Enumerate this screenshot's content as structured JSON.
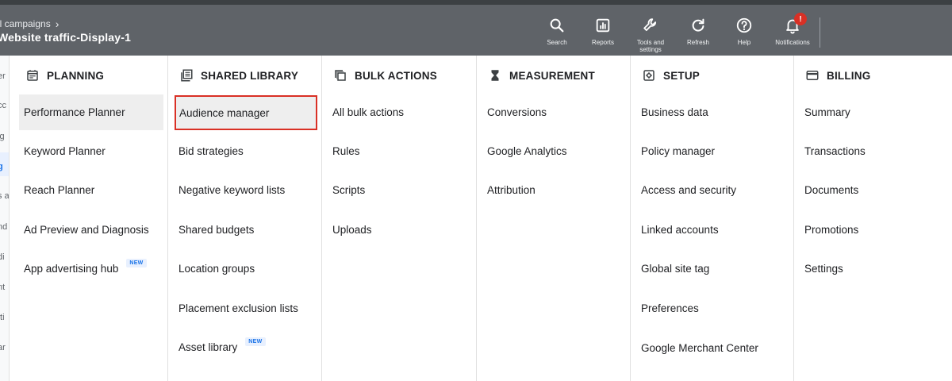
{
  "header": {
    "breadcrumb": "ll campaigns",
    "title": "Website traffic-Display-1",
    "tools": [
      {
        "label": "Search",
        "icon": "search-icon"
      },
      {
        "label": "Reports",
        "icon": "reports-icon"
      },
      {
        "label": "Tools and settings",
        "icon": "wrench-icon"
      },
      {
        "label": "Refresh",
        "icon": "refresh-icon"
      },
      {
        "label": "Help",
        "icon": "help-icon"
      },
      {
        "label": "Notifications",
        "icon": "bell-icon",
        "badge": "!"
      }
    ]
  },
  "left_rail": [
    "er",
    "cc",
    "ig",
    "g",
    "s a",
    "nd",
    "di",
    "nt",
    "tti",
    "ar"
  ],
  "columns": [
    {
      "heading": "PLANNING",
      "icon": "calendar-icon",
      "items": [
        {
          "label": "Performance Planner",
          "state": "selected"
        },
        {
          "label": "Keyword Planner"
        },
        {
          "label": "Reach Planner"
        },
        {
          "label": "Ad Preview and Diagnosis"
        },
        {
          "label": "App advertising hub",
          "badge": "NEW"
        }
      ]
    },
    {
      "heading": "SHARED LIBRARY",
      "icon": "library-icon",
      "items": [
        {
          "label": "Audience manager",
          "state": "outlined"
        },
        {
          "label": "Bid strategies"
        },
        {
          "label": "Negative keyword lists"
        },
        {
          "label": "Shared budgets"
        },
        {
          "label": "Location groups"
        },
        {
          "label": "Placement exclusion lists"
        },
        {
          "label": "Asset library",
          "badge": "NEW"
        }
      ]
    },
    {
      "heading": "BULK ACTIONS",
      "icon": "copy-icon",
      "items": [
        {
          "label": "All bulk actions"
        },
        {
          "label": "Rules"
        },
        {
          "label": "Scripts"
        },
        {
          "label": "Uploads"
        }
      ]
    },
    {
      "heading": "MEASUREMENT",
      "icon": "hourglass-icon",
      "items": [
        {
          "label": "Conversions"
        },
        {
          "label": "Google Analytics"
        },
        {
          "label": "Attribution"
        }
      ]
    },
    {
      "heading": "SETUP",
      "icon": "setup-icon",
      "items": [
        {
          "label": "Business data"
        },
        {
          "label": "Policy manager"
        },
        {
          "label": "Access and security"
        },
        {
          "label": "Linked accounts"
        },
        {
          "label": "Global site tag"
        },
        {
          "label": "Preferences"
        },
        {
          "label": "Google Merchant Center"
        }
      ]
    },
    {
      "heading": "BILLING",
      "icon": "card-icon",
      "items": [
        {
          "label": "Summary"
        },
        {
          "label": "Transactions"
        },
        {
          "label": "Documents"
        },
        {
          "label": "Promotions"
        },
        {
          "label": "Settings"
        }
      ]
    }
  ],
  "colors": {
    "header_bg": "#5f6368",
    "selected_bg": "#eeeeee",
    "outline": "#d93025",
    "new_badge": "#1a73e8"
  }
}
